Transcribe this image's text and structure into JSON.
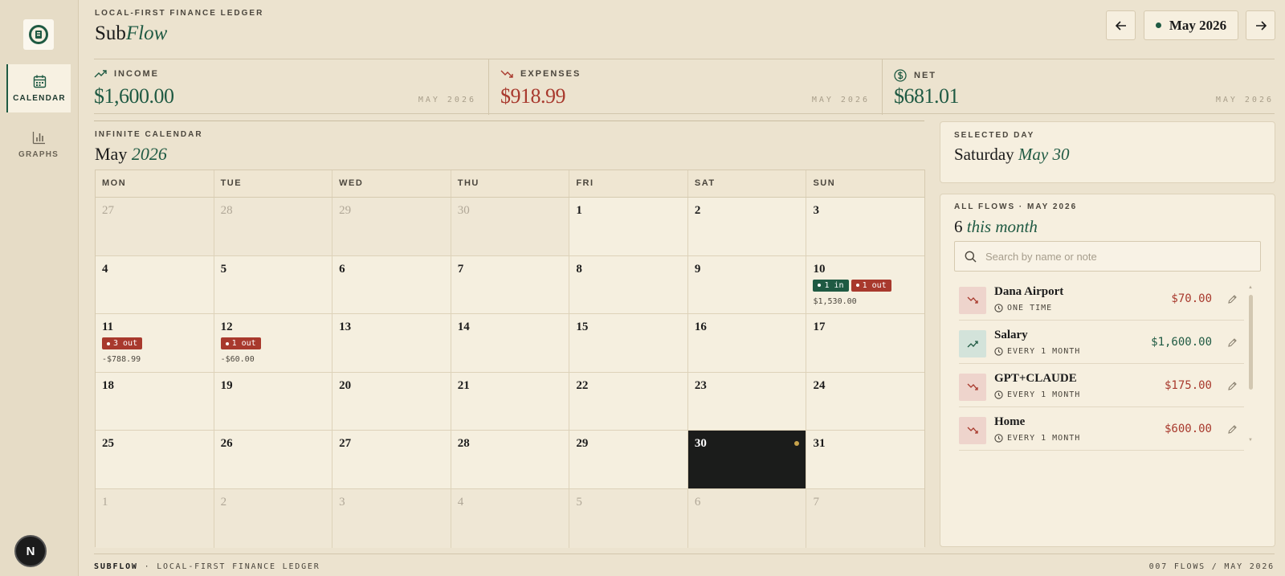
{
  "app": {
    "eyebrow": "LOCAL-FIRST FINANCE LEDGER",
    "title_main": "Sub",
    "title_accent": "Flow"
  },
  "sidebar": {
    "items": [
      {
        "label": "CALENDAR",
        "icon": "calendar-icon",
        "active": true
      },
      {
        "label": "GRAPHS",
        "icon": "bar-chart-icon",
        "active": false
      }
    ],
    "avatar_letter": "N"
  },
  "header": {
    "month_label": "May 2026",
    "prev_icon": "arrow-left-icon",
    "next_icon": "arrow-right-icon"
  },
  "summary": {
    "income": {
      "label": "INCOME",
      "value": "$1,600.00",
      "sub": "MAY 2026",
      "color": "#1f5a43"
    },
    "expenses": {
      "label": "EXPENSES",
      "value": "$918.99",
      "sub": "MAY 2026",
      "color": "#a8392d"
    },
    "net": {
      "label": "NET",
      "value": "$681.01",
      "sub": "MAY 2026",
      "color": "#1f5a43"
    }
  },
  "calendar": {
    "eyebrow": "INFINITE CALENDAR",
    "title_main": "May",
    "title_accent": "2026",
    "weekdays": [
      "MON",
      "TUE",
      "WED",
      "THU",
      "FRI",
      "SAT",
      "SUN"
    ],
    "weeks": [
      [
        {
          "d": "27",
          "out": true
        },
        {
          "d": "28",
          "out": true
        },
        {
          "d": "29",
          "out": true
        },
        {
          "d": "30",
          "out": true
        },
        {
          "d": "1"
        },
        {
          "d": "2"
        },
        {
          "d": "3"
        }
      ],
      [
        {
          "d": "4"
        },
        {
          "d": "5"
        },
        {
          "d": "6"
        },
        {
          "d": "7"
        },
        {
          "d": "8"
        },
        {
          "d": "9"
        },
        {
          "d": "10",
          "in": "1 in",
          "outb": "1 out",
          "amount": "$1,530.00"
        }
      ],
      [
        {
          "d": "11",
          "outb": "3 out",
          "amount": "-$788.99"
        },
        {
          "d": "12",
          "outb": "1 out",
          "amount": "-$60.00"
        },
        {
          "d": "13"
        },
        {
          "d": "14"
        },
        {
          "d": "15"
        },
        {
          "d": "16"
        },
        {
          "d": "17"
        }
      ],
      [
        {
          "d": "18"
        },
        {
          "d": "19"
        },
        {
          "d": "20"
        },
        {
          "d": "21"
        },
        {
          "d": "22"
        },
        {
          "d": "23"
        },
        {
          "d": "24"
        }
      ],
      [
        {
          "d": "25"
        },
        {
          "d": "26"
        },
        {
          "d": "27"
        },
        {
          "d": "28"
        },
        {
          "d": "29"
        },
        {
          "d": "30",
          "selected": true
        },
        {
          "d": "31"
        }
      ],
      [
        {
          "d": "1",
          "out": true
        },
        {
          "d": "2",
          "out": true
        },
        {
          "d": "3",
          "out": true
        },
        {
          "d": "4",
          "out": true
        },
        {
          "d": "5",
          "out": true
        },
        {
          "d": "6",
          "out": true
        },
        {
          "d": "7",
          "out": true
        }
      ]
    ]
  },
  "selected_day": {
    "eyebrow": "SELECTED DAY",
    "weekday": "Saturday",
    "date": "May 30"
  },
  "flows": {
    "eyebrow": "ALL FLOWS · MAY 2026",
    "count": "6",
    "count_suffix": "this month",
    "search_placeholder": "Search by name or note",
    "items": [
      {
        "name": "Dana Airport",
        "freq": "ONE TIME",
        "amount": "$70.00",
        "dir": "down"
      },
      {
        "name": "Salary",
        "freq": "EVERY 1 MONTH",
        "amount": "$1,600.00",
        "dir": "up"
      },
      {
        "name": "GPT+CLAUDE",
        "freq": "EVERY 1 MONTH",
        "amount": "$175.00",
        "dir": "down"
      },
      {
        "name": "Home",
        "freq": "EVERY 1 MONTH",
        "amount": "$600.00",
        "dir": "down"
      }
    ]
  },
  "footer": {
    "left_brand": "SUBFLOW",
    "left_sep": " · ",
    "left_text": "LOCAL-FIRST FINANCE LEDGER",
    "right_text": "007 FLOWS / MAY 2026"
  }
}
